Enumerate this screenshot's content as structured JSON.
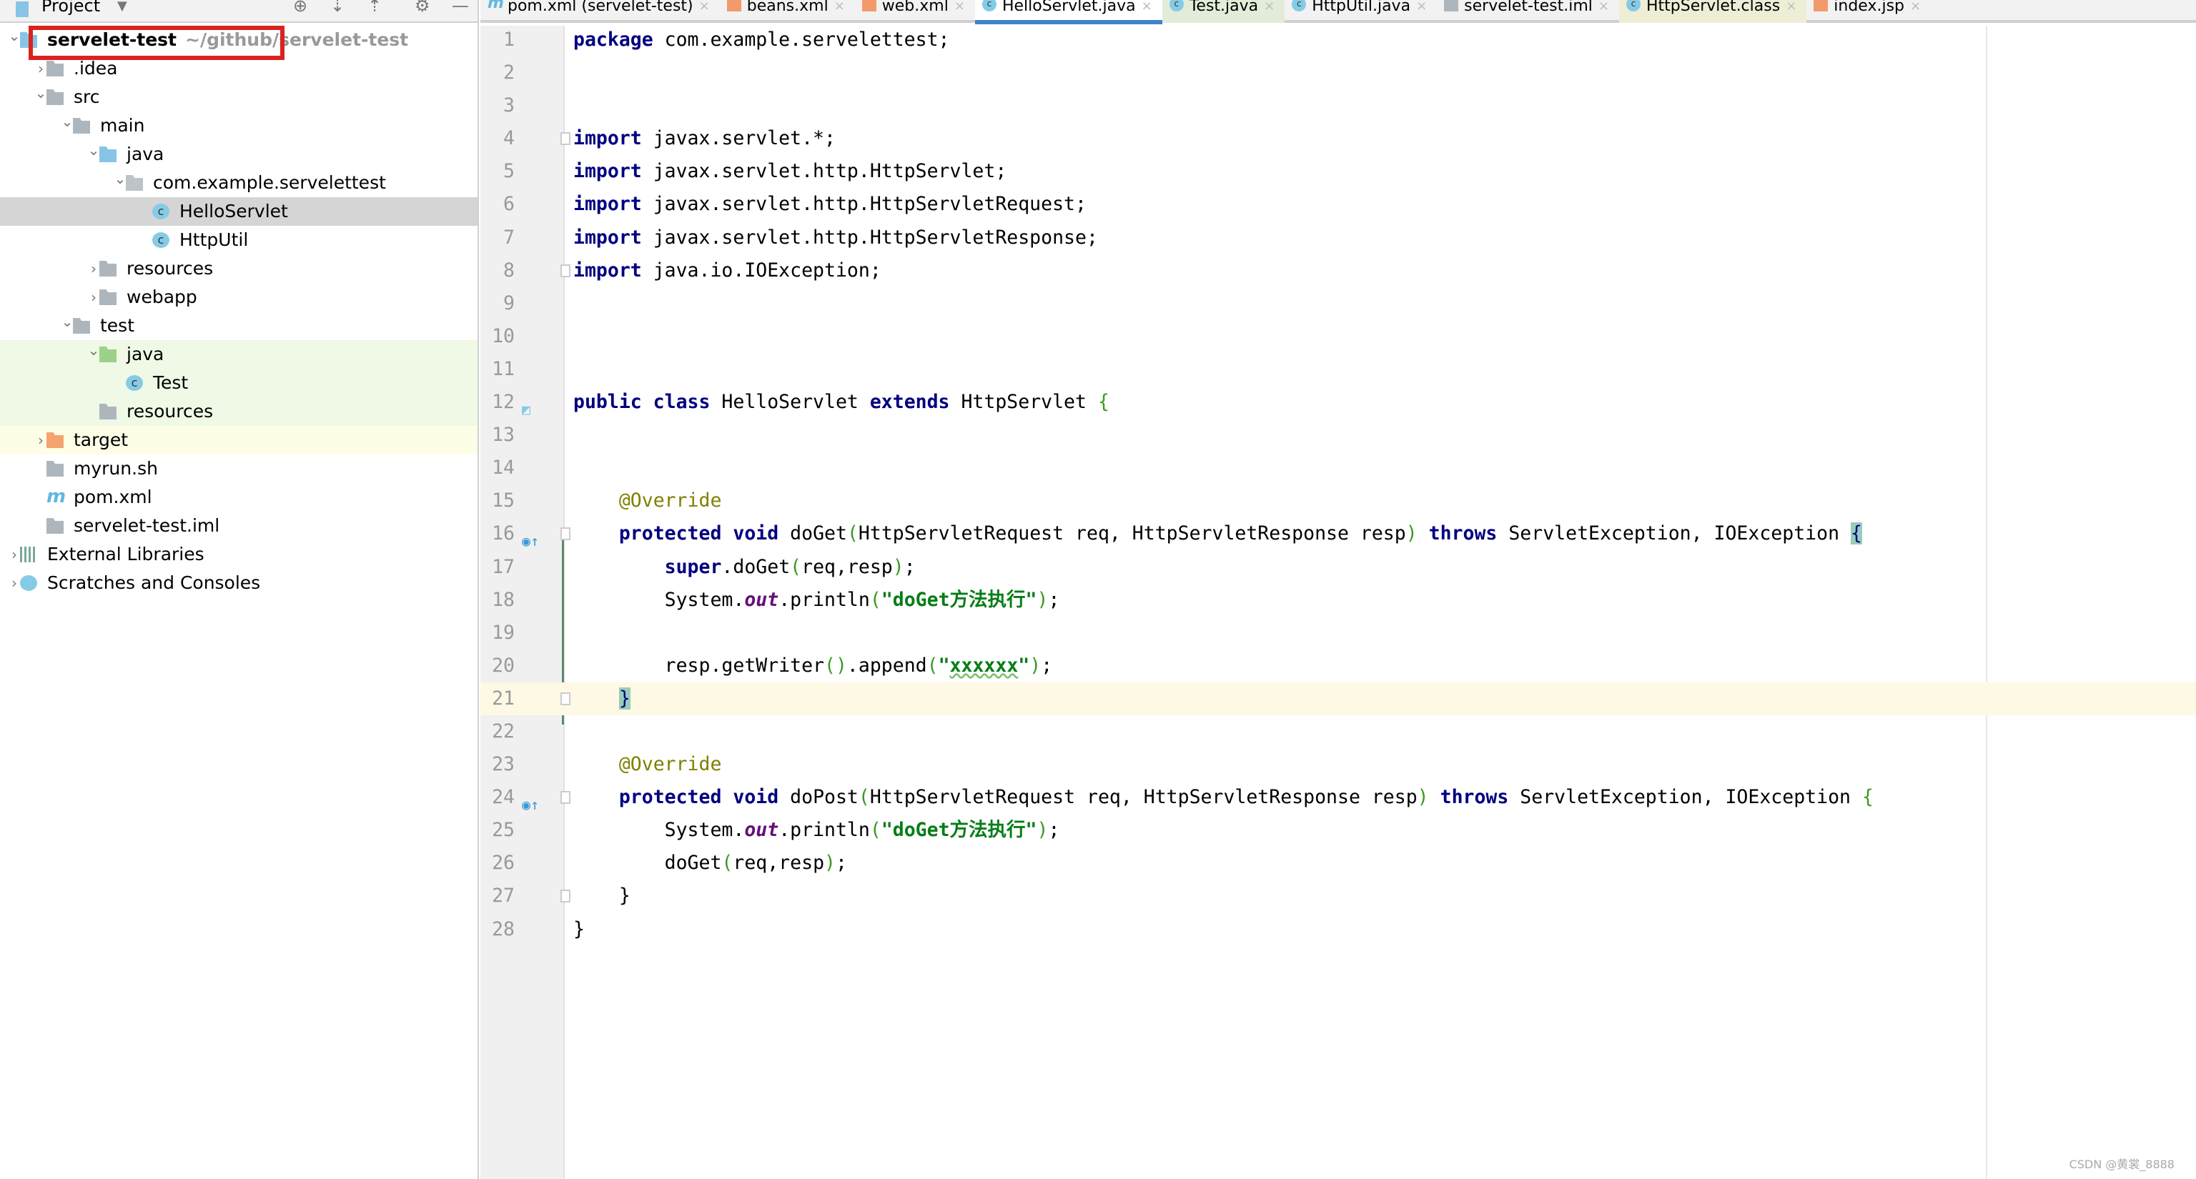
{
  "project_panel": {
    "title": "Project",
    "dropdown": "▼",
    "toolbar_icons": [
      "locate-icon",
      "expand-all-icon",
      "collapse-all-icon",
      "gear-icon",
      "minimize-icon"
    ],
    "tree": [
      {
        "label": "servelet-test",
        "hint": "~/github/servelet-test",
        "level": 0,
        "arrow": "open",
        "icon": "module",
        "bold": true
      },
      {
        "label": ".idea",
        "level": 1,
        "arrow": "closed",
        "icon": "folder"
      },
      {
        "label": "src",
        "level": 1,
        "arrow": "open",
        "icon": "folder"
      },
      {
        "label": "main",
        "level": 2,
        "arrow": "open",
        "icon": "folder"
      },
      {
        "label": "java",
        "level": 3,
        "arrow": "open",
        "icon": "folder-blue"
      },
      {
        "label": "com.example.servelettest",
        "level": 4,
        "arrow": "open",
        "icon": "package"
      },
      {
        "label": "HelloServlet",
        "level": 5,
        "icon": "class",
        "state": "selected"
      },
      {
        "label": "HttpUtil",
        "level": 5,
        "icon": "class"
      },
      {
        "label": "resources",
        "level": 3,
        "arrow": "closed",
        "icon": "resources-folder"
      },
      {
        "label": "webapp",
        "level": 3,
        "arrow": "closed",
        "icon": "web-folder"
      },
      {
        "label": "test",
        "level": 2,
        "arrow": "open",
        "icon": "folder"
      },
      {
        "label": "java",
        "level": 3,
        "arrow": "open",
        "icon": "folder-green",
        "state": "test"
      },
      {
        "label": "Test",
        "level": 4,
        "icon": "test-class",
        "state": "test"
      },
      {
        "label": "resources",
        "level": 3,
        "icon": "test-resources-folder",
        "state": "test"
      },
      {
        "label": "target",
        "level": 1,
        "arrow": "closed",
        "icon": "folder-orange",
        "state": "excluded"
      },
      {
        "label": "myrun.sh",
        "level": 1,
        "icon": "shell"
      },
      {
        "label": "pom.xml",
        "level": 1,
        "icon": "maven"
      },
      {
        "label": "servelet-test.iml",
        "level": 1,
        "icon": "iml"
      },
      {
        "label": "External Libraries",
        "level": 0,
        "arrow": "closed",
        "icon": "libraries"
      },
      {
        "label": "Scratches and Consoles",
        "level": 0,
        "arrow": "closed",
        "icon": "scratches"
      }
    ]
  },
  "tabs": [
    {
      "label": "pom.xml (servelet-test)",
      "icon": "m"
    },
    {
      "label": "beans.xml",
      "icon": "xml"
    },
    {
      "label": "web.xml",
      "icon": "xml"
    },
    {
      "label": "HelloServlet.java",
      "icon": "c",
      "active": true
    },
    {
      "label": "Test.java",
      "icon": "c",
      "bg": "green"
    },
    {
      "label": "HttpUtil.java",
      "icon": "c"
    },
    {
      "label": "servelet-test.iml",
      "icon": "sq"
    },
    {
      "label": "HttpServlet.class",
      "icon": "c",
      "bg": "yellow"
    },
    {
      "label": "index.jsp",
      "icon": "jsp"
    }
  ],
  "tab_close": "×",
  "editor": {
    "current_line": 21,
    "lines": [
      [
        [
          "package",
          "kw"
        ],
        [
          " com.example.servelettest;",
          ""
        ]
      ],
      [],
      [],
      [
        [
          "import",
          "kw"
        ],
        [
          " javax.servlet.*;",
          ""
        ]
      ],
      [
        [
          "import",
          "kw"
        ],
        [
          " javax.servlet.http.HttpServlet;",
          ""
        ]
      ],
      [
        [
          "import",
          "kw"
        ],
        [
          " javax.servlet.http.HttpServletRequest;",
          ""
        ]
      ],
      [
        [
          "import",
          "kw"
        ],
        [
          " javax.servlet.http.HttpServletResponse;",
          ""
        ]
      ],
      [
        [
          "import",
          "kw"
        ],
        [
          " java.io.IOException;",
          ""
        ]
      ],
      [],
      [],
      [],
      [
        [
          "public class",
          "kw"
        ],
        [
          " HelloServlet ",
          ""
        ],
        [
          "extends",
          "kw"
        ],
        [
          " HttpServlet ",
          ""
        ],
        [
          "{",
          "pa"
        ]
      ],
      [],
      [],
      [
        [
          "    ",
          ""
        ],
        [
          "@Override",
          "an"
        ]
      ],
      [
        [
          "    ",
          ""
        ],
        [
          "protected void",
          "kw"
        ],
        [
          " doGet",
          ""
        ],
        [
          "(",
          "pa"
        ],
        [
          "HttpServletRequest req, HttpServletResponse resp",
          ""
        ],
        [
          ")",
          "pa"
        ],
        [
          " ",
          ""
        ],
        [
          "throws",
          "kw"
        ],
        [
          " ServletException, IOException ",
          ""
        ],
        [
          "{",
          "br"
        ]
      ],
      [
        [
          "        ",
          ""
        ],
        [
          "super",
          "kw"
        ],
        [
          ".doGet",
          ""
        ],
        [
          "(",
          "pa"
        ],
        [
          "req,resp",
          ""
        ],
        [
          ")",
          "pa"
        ],
        [
          ";",
          ""
        ]
      ],
      [
        [
          "        System.",
          ""
        ],
        [
          "out",
          "pu"
        ],
        [
          ".println",
          ""
        ],
        [
          "(",
          "pa"
        ],
        [
          "\"doGet方法执行\"",
          "st"
        ],
        [
          ")",
          "pa"
        ],
        [
          ";",
          ""
        ]
      ],
      [],
      [
        [
          "        resp.getWriter",
          ""
        ],
        [
          "()",
          "pa"
        ],
        [
          ".append",
          ""
        ],
        [
          "(",
          "pa"
        ],
        [
          "\"",
          "st"
        ],
        [
          "xxxxxx",
          "st-u"
        ],
        [
          "\"",
          "st"
        ],
        [
          ")",
          "pa"
        ],
        [
          ";",
          ""
        ]
      ],
      [
        [
          "    ",
          ""
        ],
        [
          "}",
          "br"
        ]
      ],
      [],
      [
        [
          "    ",
          ""
        ],
        [
          "@Override",
          "an"
        ]
      ],
      [
        [
          "    ",
          ""
        ],
        [
          "protected void",
          "kw"
        ],
        [
          " doPost",
          ""
        ],
        [
          "(",
          "pa"
        ],
        [
          "HttpServletRequest req, HttpServletResponse resp",
          ""
        ],
        [
          ")",
          "pa"
        ],
        [
          " ",
          ""
        ],
        [
          "throws",
          "kw"
        ],
        [
          " ServletException, IOException ",
          ""
        ],
        [
          "{",
          "pa"
        ]
      ],
      [
        [
          "        System.",
          ""
        ],
        [
          "out",
          "pu"
        ],
        [
          ".println",
          ""
        ],
        [
          "(",
          "pa"
        ],
        [
          "\"doGet方法执行\"",
          "st"
        ],
        [
          ")",
          "pa"
        ],
        [
          ";",
          ""
        ]
      ],
      [
        [
          "        doGet",
          ""
        ],
        [
          "(",
          "pa"
        ],
        [
          "req,resp",
          ""
        ],
        [
          ")",
          "pa"
        ],
        [
          ";",
          ""
        ]
      ],
      [
        [
          "    }",
          ""
        ]
      ],
      [
        [
          "}",
          ""
        ]
      ]
    ],
    "gutter_icons": {
      "12": "class-icon",
      "16": "override-icon",
      "24": "override-icon"
    },
    "fold_markers": [
      4,
      8,
      16,
      21,
      24,
      27
    ]
  },
  "watermark": "CSDN @黄裳_8888",
  "colors": {
    "keyword": "#000080",
    "string": "#067d17",
    "annotation": "#808000",
    "selection": "#d5d5d5",
    "active_tab": "#4083c9",
    "highlight_box": "#d9231f"
  }
}
